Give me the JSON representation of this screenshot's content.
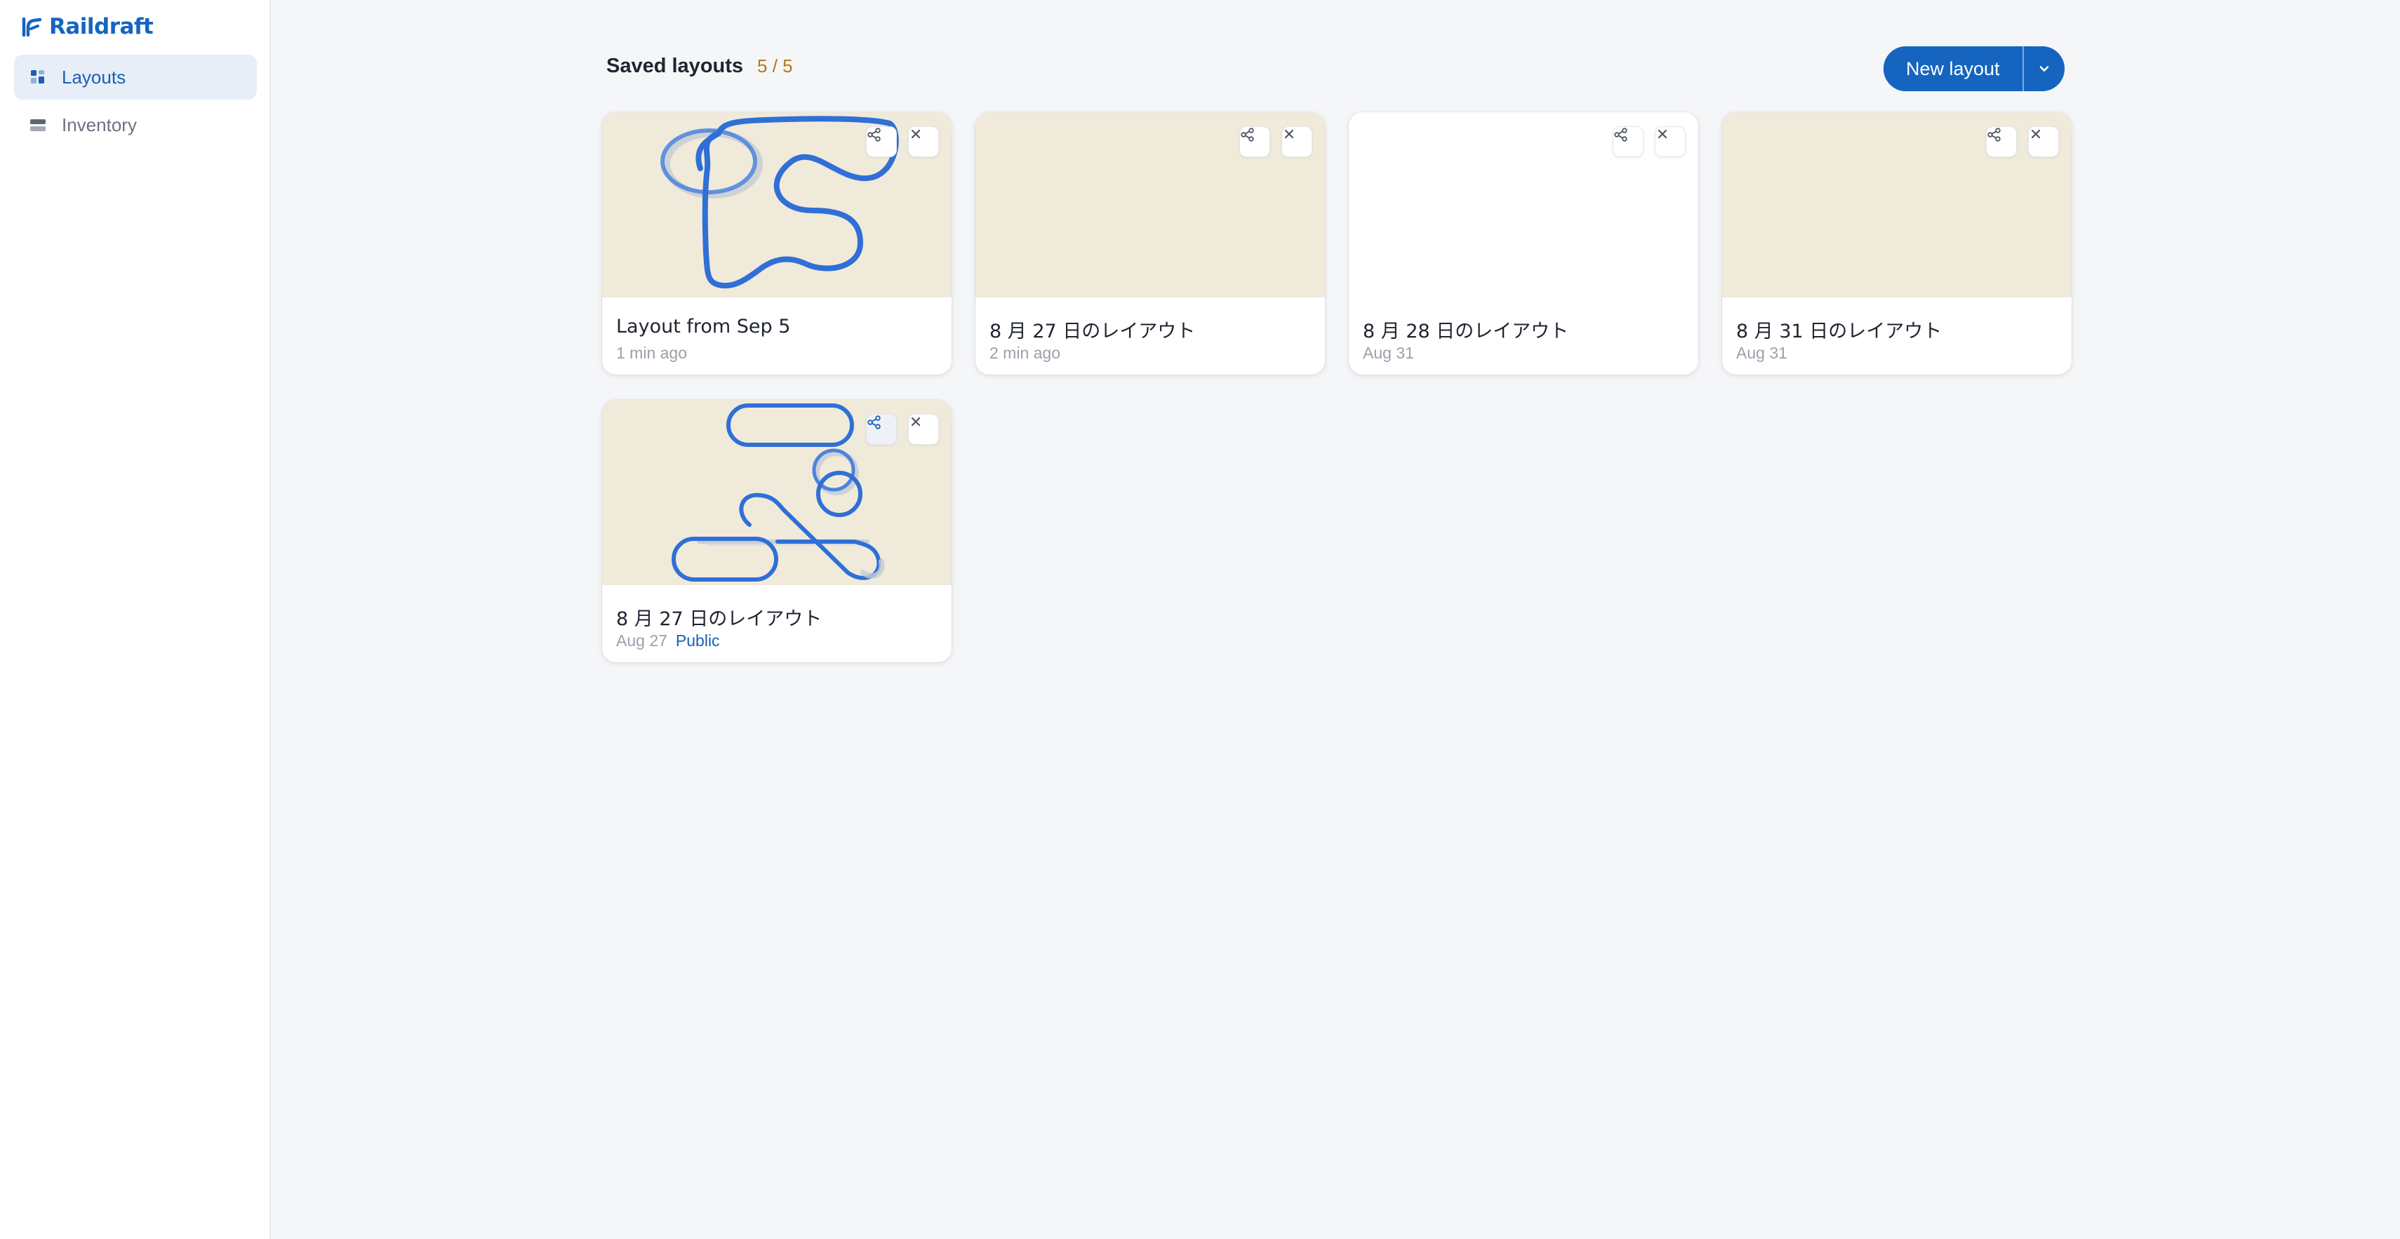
{
  "app": {
    "name": "Raildraft"
  },
  "sidebar": {
    "items": [
      {
        "label": "Layouts",
        "icon": "grid-icon",
        "active": true
      },
      {
        "label": "Inventory",
        "icon": "stack-icon",
        "active": false
      }
    ]
  },
  "header": {
    "title": "Saved layouts",
    "count": "5 / 5",
    "new_button": "New layout"
  },
  "colors": {
    "accent": "#1565c0",
    "track": "#2f6fd6",
    "thumb_bg": "#f0eadb",
    "count": "#b27a12"
  },
  "layouts": [
    {
      "title": "Layout from Sep 5",
      "time": "1 min ago",
      "badge": ""
    },
    {
      "title": "8 月 27 日のレイアウト",
      "time": "2 min ago",
      "badge": ""
    },
    {
      "title": "8 月 28 日のレイアウト",
      "time": "Aug 31",
      "badge": ""
    },
    {
      "title": "8 月 31 日のレイアウト",
      "time": "Aug 31",
      "badge": ""
    },
    {
      "title": "8 月 27 日のレイアウト",
      "time": "Aug 27",
      "badge": "Public"
    }
  ]
}
